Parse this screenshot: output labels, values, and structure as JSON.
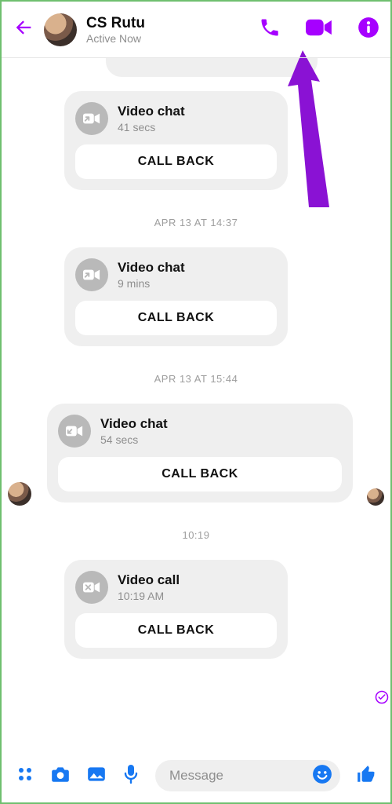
{
  "colors": {
    "accent": "#a600ff",
    "fb": "#1778f2"
  },
  "header": {
    "name": "CS Rutu",
    "status": "Active Now"
  },
  "timestamps": {
    "t1": "APR 13 AT 14:37",
    "t2": "APR 13 AT 15:44",
    "t3": "10:19"
  },
  "cards": [
    {
      "title": "Video chat",
      "sub": "41 secs",
      "btn": "CALL BACK",
      "icon": "cam-out"
    },
    {
      "title": "Video chat",
      "sub": "9 mins",
      "btn": "CALL BACK",
      "icon": "cam-out"
    },
    {
      "title": "Video chat",
      "sub": "54 secs",
      "btn": "CALL BACK",
      "icon": "cam-in"
    },
    {
      "title": "Video call",
      "sub": "10:19 AM",
      "btn": "CALL BACK",
      "icon": "cam-miss"
    }
  ],
  "composer": {
    "placeholder": "Message"
  },
  "icons": {
    "back": "back-arrow-icon",
    "phone": "phone-icon",
    "video": "video-icon",
    "info": "info-icon",
    "apps": "apps-icon",
    "camera": "camera-icon",
    "gallery": "gallery-icon",
    "mic": "mic-icon",
    "emoji": "emoji-icon",
    "like": "like-icon"
  }
}
